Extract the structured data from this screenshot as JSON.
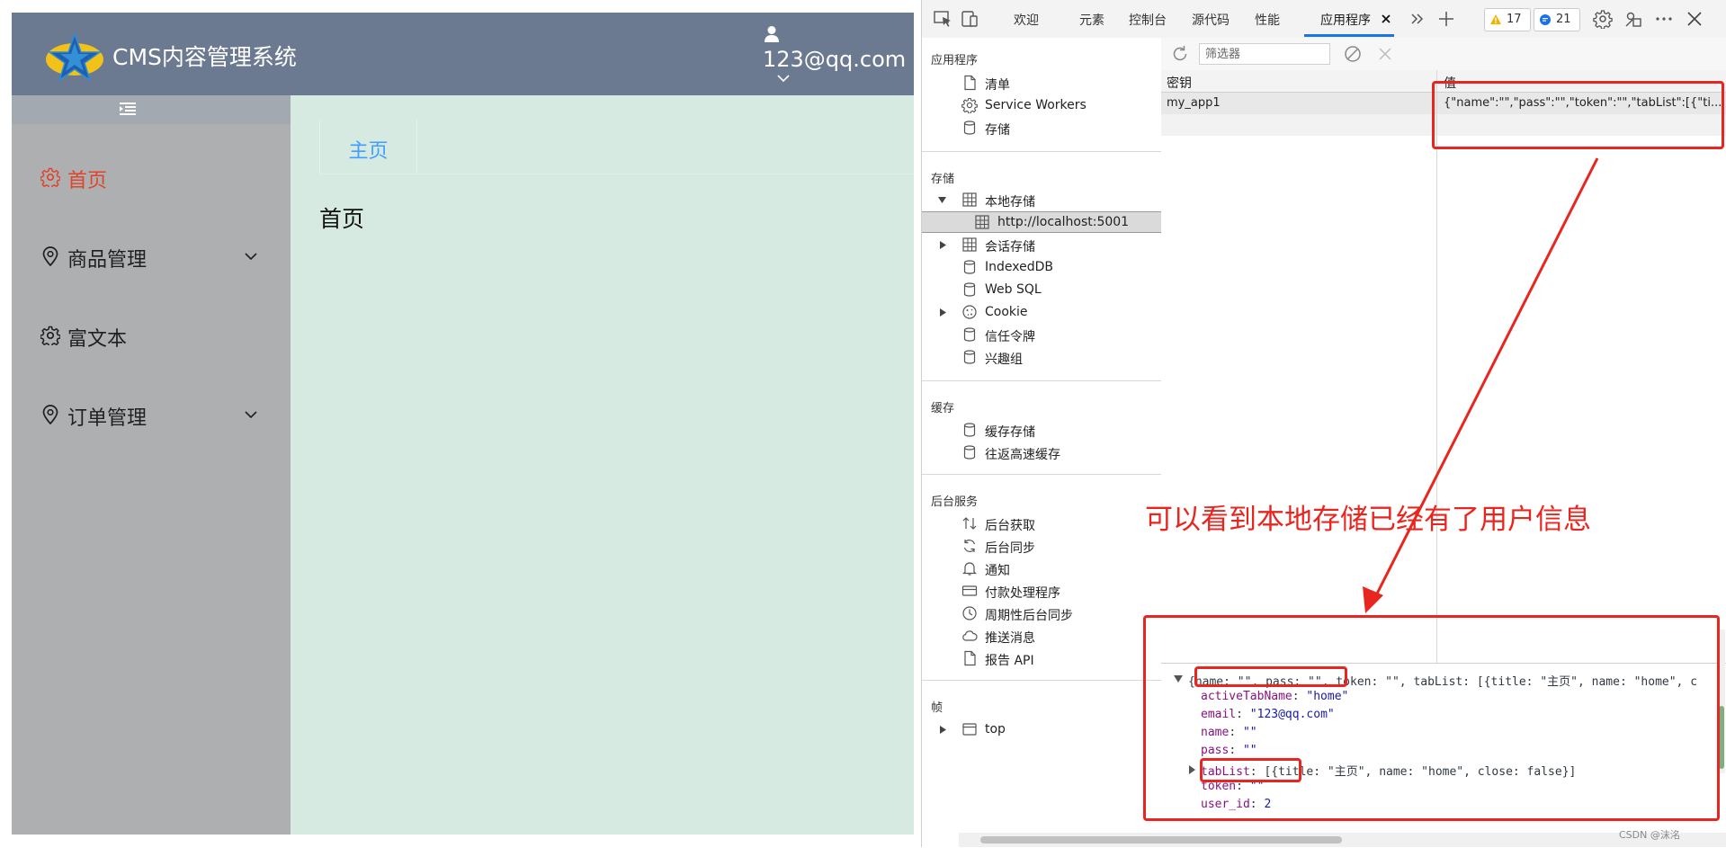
{
  "app": {
    "title": "CMS内容管理系统",
    "user_email": "123@qq.com",
    "menu": [
      {
        "label": "首页",
        "active": true
      },
      {
        "label": "商品管理",
        "has_submenu": true
      },
      {
        "label": "富文本"
      },
      {
        "label": "订单管理",
        "has_submenu": true
      }
    ],
    "tab_label": "主页",
    "content_text": "首页",
    "colors": {
      "header": "#6b7a90",
      "sidebar": "#adafb1",
      "content": "#d6eae1",
      "active": "#e0442b",
      "tab": "#409eff"
    }
  },
  "devtools": {
    "tabs": [
      "欢迎",
      "元素",
      "控制台",
      "源代码",
      "性能",
      "应用程序"
    ],
    "active_tab": "应用程序",
    "warnings_count": "17",
    "messages_count": "21",
    "sections": {
      "application": {
        "title": "应用程序",
        "items": [
          "清单",
          "Service Workers",
          "存储"
        ]
      },
      "storage": {
        "title": "存储",
        "local_storage": "本地存储",
        "local_origin": "http://localhost:5001",
        "items": [
          "会话存储",
          "IndexedDB",
          "Web SQL",
          "Cookie",
          "信任令牌",
          "兴趣组"
        ]
      },
      "cache": {
        "title": "缓存",
        "items": [
          "缓存存储",
          "往返高速缓存"
        ]
      },
      "background": {
        "title": "后台服务",
        "items": [
          "后台获取",
          "后台同步",
          "通知",
          "付款处理程序",
          "周期性后台同步",
          "推送消息",
          "报告 API"
        ]
      },
      "frames": {
        "title": "帧",
        "items": [
          "top"
        ]
      }
    },
    "filter_placeholder": "筛选器",
    "columns": {
      "key": "密钥",
      "value": "值"
    },
    "row": {
      "key": "my_app1",
      "value": "{\"name\":\"\",\"pass\":\"\",\"token\":\"\",\"tabList\":[{\"ti..."
    },
    "preview": {
      "summary": "{name: \"\", pass: \"\", token: \"\", tabList: [{title: \"主页\", name: \"home\", c",
      "lines": [
        {
          "key": "activeTabName",
          "value": "\"home\""
        },
        {
          "key": "email",
          "value": "\"123@qq.com\""
        },
        {
          "key": "name",
          "value": "\"\""
        },
        {
          "key": "pass",
          "value": "\"\""
        },
        {
          "key": "tabList",
          "value": "[{title: \"主页\", name: \"home\", close: false}]"
        },
        {
          "key": "token",
          "value": "\"\""
        },
        {
          "key": "user_id",
          "value": "2"
        }
      ]
    }
  },
  "annotation": "可以看到本地存储已经有了用户信息",
  "watermark": "CSDN @沫洺",
  "accent_color": "#e8261f"
}
